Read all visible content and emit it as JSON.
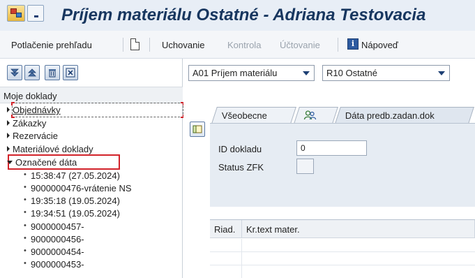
{
  "window": {
    "title": "Príjem materiálu Ostatné - Adriana Testovacia"
  },
  "toolbar": {
    "overview_toggle": "Potlačenie prehľadu",
    "new_doc_icon": "document-icon",
    "hold": "Uchovanie",
    "check": "Kontrola",
    "post": "Účtovanie",
    "help": "Nápoveď",
    "help_icon": "info-icon"
  },
  "left_panel": {
    "buttons": [
      "expand-all-icon",
      "collapse-all-icon",
      "trash-icon",
      "close-icon"
    ],
    "header": "Moje doklady",
    "nodes": [
      {
        "label": "Objednávky",
        "expanded": false
      },
      {
        "label": "Zákazky",
        "expanded": false
      },
      {
        "label": "Rezervácie",
        "expanded": false
      },
      {
        "label": "Materiálové doklady",
        "expanded": false
      },
      {
        "label": "Označené dáta",
        "expanded": true
      }
    ],
    "subitems": [
      "15:38:47 (27.05.2024)",
      "9000000476-vrátenie NS",
      "19:35:18 (19.05.2024)",
      "19:34:51 (19.05.2024)",
      "9000000457-",
      "9000000456-",
      "9000000454-",
      "9000000453-"
    ]
  },
  "header_selects": {
    "transaction": "A01 Príjem materiálu",
    "reference": "R10 Ostatné"
  },
  "tabs": [
    {
      "label": "Všeobecne",
      "active": false
    },
    {
      "label": "",
      "icon": "partners-icon",
      "active": false
    },
    {
      "label": "Dáta predb.zadan.dok",
      "active": true
    }
  ],
  "form": {
    "doc_id_label": "ID dokladu",
    "doc_id_value": "0",
    "status_label": "Status ZFK",
    "status_value": ""
  },
  "table": {
    "columns": [
      "Riad.",
      "Kr.text mater."
    ]
  },
  "colors": {
    "title": "#17365f",
    "highlight": "#d2232a",
    "panel_bg": "#e6ecf3"
  }
}
